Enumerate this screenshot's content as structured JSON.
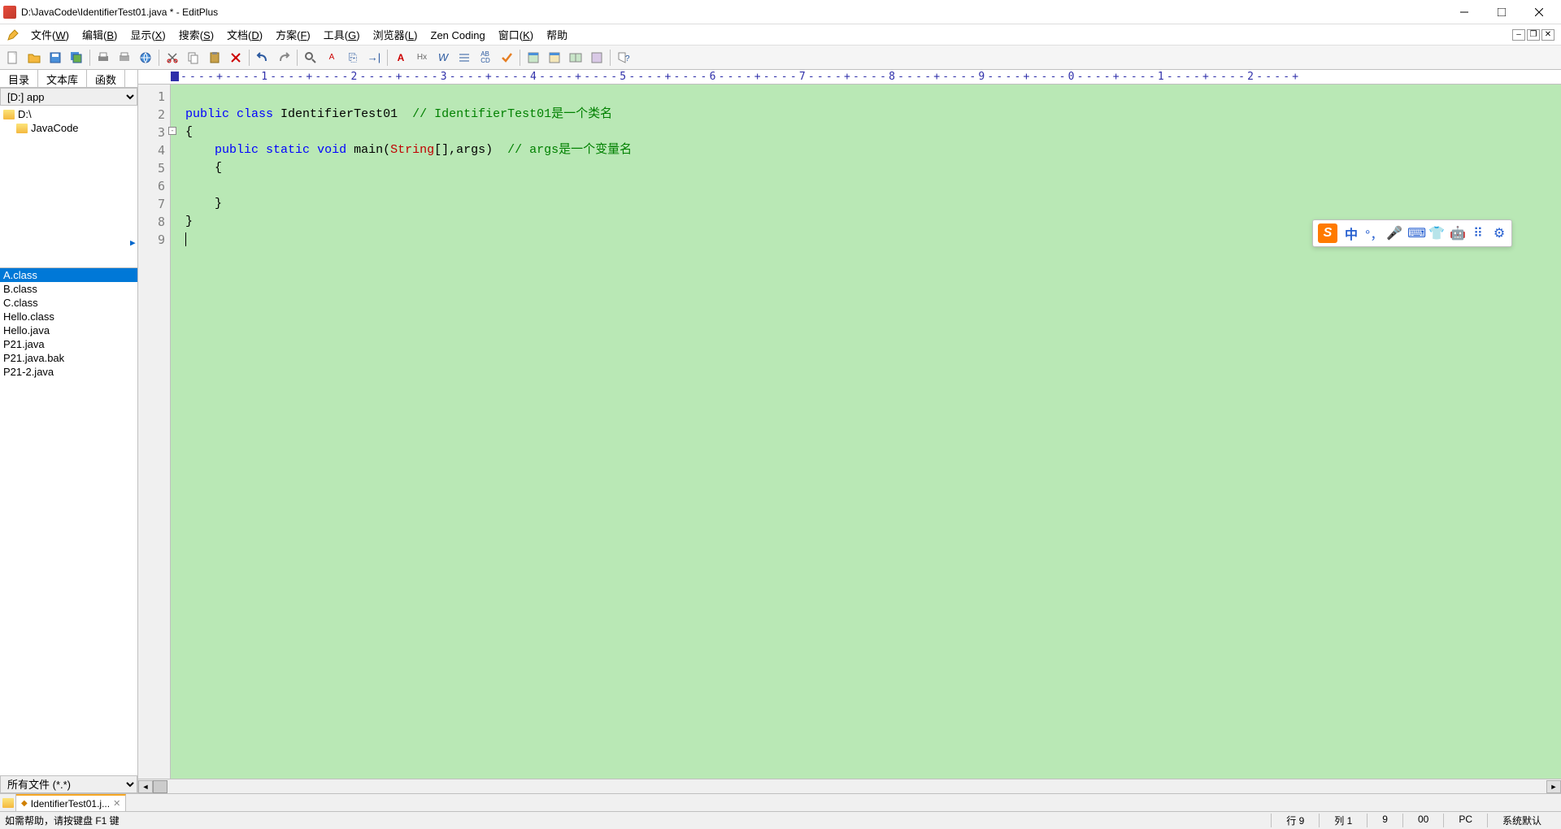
{
  "title": "D:\\JavaCode\\IdentifierTest01.java * - EditPlus",
  "menus": [
    "文件(W)",
    "编辑(B)",
    "显示(X)",
    "搜索(S)",
    "文档(D)",
    "方案(F)",
    "工具(G)",
    "浏览器(L)",
    "Zen Coding",
    "窗口(K)",
    "帮助"
  ],
  "sidebar": {
    "tabs": [
      "目录",
      "文本库",
      "函数"
    ],
    "drive": "[D:] app",
    "folders": [
      "D:\\",
      "JavaCode"
    ],
    "files": [
      "A.class",
      "B.class",
      "C.class",
      "Hello.class",
      "Hello.java",
      "P21.java",
      "P21.java.bak",
      "P21-2.java"
    ],
    "selected_file_index": 0,
    "filter": "所有文件 (*.*)"
  },
  "ruler": "----+----1----+----2----+----3----+----4----+----5----+----6----+----7----+----8----+----9----+----0----+----1----+----2----+",
  "code": {
    "lines": [
      {
        "n": 1,
        "tokens": []
      },
      {
        "n": 2,
        "tokens": [
          {
            "t": "public",
            "c": "kw"
          },
          {
            "t": " "
          },
          {
            "t": "class",
            "c": "kw"
          },
          {
            "t": " IdentifierTest01  "
          },
          {
            "t": "// IdentifierTest01是一个类名",
            "c": "comment"
          }
        ]
      },
      {
        "n": 3,
        "fold": true,
        "tokens": [
          {
            "t": "{"
          }
        ]
      },
      {
        "n": 4,
        "tokens": [
          {
            "t": "    "
          },
          {
            "t": "public",
            "c": "kw"
          },
          {
            "t": " "
          },
          {
            "t": "static",
            "c": "kw"
          },
          {
            "t": " "
          },
          {
            "t": "void",
            "c": "kw"
          },
          {
            "t": " main("
          },
          {
            "t": "String",
            "c": "type"
          },
          {
            "t": "[],args)  "
          },
          {
            "t": "// args是一个变量名",
            "c": "comment"
          }
        ]
      },
      {
        "n": 5,
        "tokens": [
          {
            "t": "    {"
          }
        ]
      },
      {
        "n": 6,
        "tokens": []
      },
      {
        "n": 7,
        "tokens": [
          {
            "t": "    }"
          }
        ]
      },
      {
        "n": 8,
        "tokens": [
          {
            "t": "}"
          }
        ]
      },
      {
        "n": 9,
        "cursor": true,
        "tokens": []
      }
    ]
  },
  "doc_tab": {
    "name": "IdentifierTest01.j..."
  },
  "status": {
    "help": "如需帮助，请按键盘 F1 键",
    "line": "行 9",
    "col": "列 1",
    "chars": "9",
    "sel": "00",
    "enc": "PC",
    "mode": "系统默认"
  },
  "ime": {
    "lang": "中"
  }
}
